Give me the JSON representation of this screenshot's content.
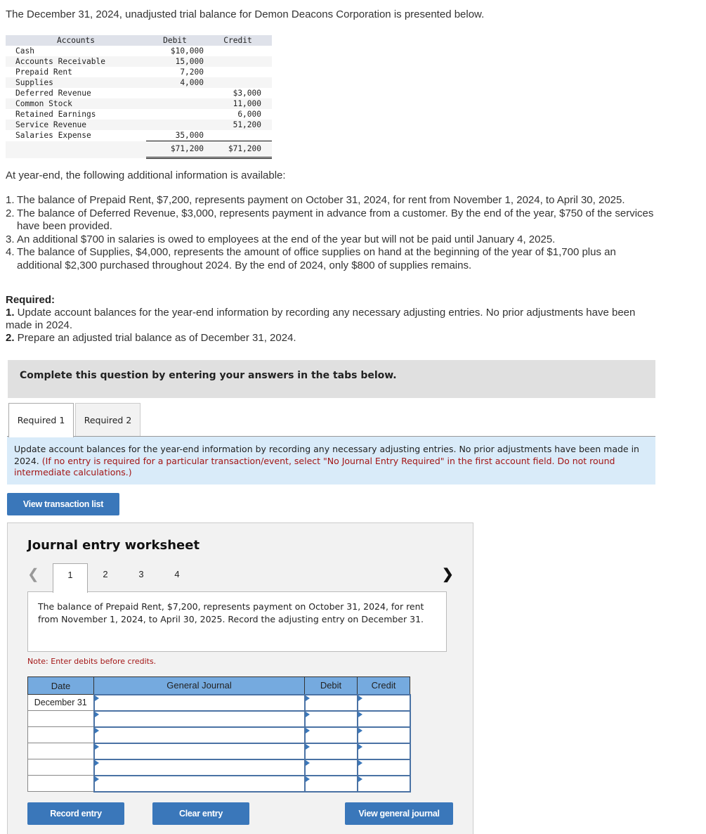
{
  "intro": "The December 31, 2024, unadjusted trial balance for Demon Deacons Corporation is presented below.",
  "trial_balance": {
    "headers": {
      "accounts": "Accounts",
      "debit": "Debit",
      "credit": "Credit"
    },
    "rows": [
      {
        "account": "Cash",
        "debit": "$10,000",
        "credit": ""
      },
      {
        "account": "Accounts Receivable",
        "debit": "15,000",
        "credit": ""
      },
      {
        "account": "Prepaid Rent",
        "debit": "7,200",
        "credit": ""
      },
      {
        "account": "Supplies",
        "debit": "4,000",
        "credit": ""
      },
      {
        "account": "Deferred Revenue",
        "debit": "",
        "credit": "$3,000"
      },
      {
        "account": "Common Stock",
        "debit": "",
        "credit": "11,000"
      },
      {
        "account": "Retained Earnings",
        "debit": "",
        "credit": "6,000"
      },
      {
        "account": "Service Revenue",
        "debit": "",
        "credit": "51,200"
      },
      {
        "account": "Salaries Expense",
        "debit": "35,000",
        "credit": ""
      }
    ],
    "totals": {
      "debit": "$71,200",
      "credit": "$71,200"
    }
  },
  "additional_info_heading": "At year-end, the following additional information is available:",
  "additional_info": [
    {
      "num": "1.",
      "text": "The balance of Prepaid Rent, $7,200, represents payment on October 31, 2024, for rent from November 1, 2024, to April 30, 2025."
    },
    {
      "num": "2.",
      "text": "The balance of  Deferred Revenue, $3,000, represents payment in advance from a customer. By the end of the year, $750 of the services have been provided."
    },
    {
      "num": "3.",
      "text": "An additional $700 in salaries is owed to employees at the end of the year but will not be paid until January 4, 2025."
    },
    {
      "num": "4.",
      "text": "The balance of Supplies, $4,000, represents the amount of office supplies on hand at the beginning of the year of $1,700 plus an additional $2,300 purchased throughout 2024. By the end of 2024, only $800 of supplies remains."
    }
  ],
  "required": {
    "heading": "Required:",
    "items": [
      {
        "num": "1.",
        "text": " Update account balances for the year-end information by recording any necessary adjusting entries. No prior adjustments have been made in 2024."
      },
      {
        "num": "2.",
        "text": " Prepare an adjusted trial balance as of December 31, 2024."
      }
    ]
  },
  "banner": "Complete this question by entering your answers in the tabs below.",
  "tabs": [
    {
      "label": "Required 1",
      "active": true
    },
    {
      "label": "Required 2",
      "active": false
    }
  ],
  "instructions": {
    "main": "Update account balances for the year-end information by recording any necessary adjusting entries. No prior adjustments have been made in 2024. ",
    "note": "(If no entry is required for a particular transaction/event, select \"No Journal Entry Required\" in the first account field. Do not round intermediate calculations.)"
  },
  "buttons": {
    "view_transaction_list": "View transaction list",
    "record_entry": "Record entry",
    "clear_entry": "Clear entry",
    "view_general_journal": "View general journal"
  },
  "worksheet": {
    "title": "Journal entry worksheet",
    "prev_icon": "chevron-left",
    "next_icon": "chevron-right",
    "tabs": [
      "1",
      "2",
      "3",
      "4"
    ],
    "active_tab": "1",
    "description": "The balance of Prepaid Rent, $7,200, represents payment on October 31, 2024, for rent from November 1, 2024, to April 30, 2025. Record the adjusting entry on December 31.",
    "note": "Note: Enter debits before credits.",
    "table": {
      "headers": {
        "date": "Date",
        "journal": "General Journal",
        "debit": "Debit",
        "credit": "Credit"
      },
      "rows": [
        {
          "date": "December 31",
          "account": "",
          "debit": "",
          "credit": ""
        },
        {
          "date": "",
          "account": "",
          "debit": "",
          "credit": ""
        },
        {
          "date": "",
          "account": "",
          "debit": "",
          "credit": ""
        },
        {
          "date": "",
          "account": "",
          "debit": "",
          "credit": ""
        },
        {
          "date": "",
          "account": "",
          "debit": "",
          "credit": ""
        },
        {
          "date": "",
          "account": "",
          "debit": "",
          "credit": ""
        }
      ]
    }
  },
  "colors": {
    "button_blue": "#3a77ba",
    "table_header_blue": "#75aadf",
    "instruction_bg": "#d9ebf9",
    "note_red": "#a31515"
  }
}
